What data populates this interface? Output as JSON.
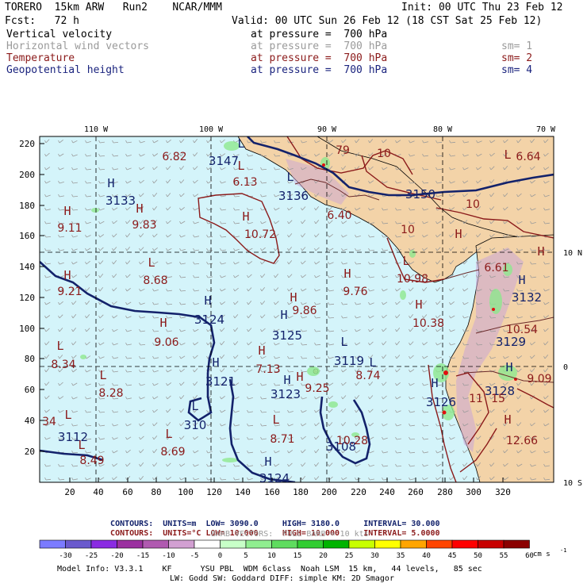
{
  "header": {
    "line1_left": "TORERO  15km ARW   Run2    NCAR/MMM",
    "line1_right": "Init: 00 UTC Thu 23 Feb 12",
    "line2_left": "Fcst:   72 h",
    "line2_right": "Valid: 00 UTC Sun 26 Feb 12 (18 CST Sat 25 Feb 12)"
  },
  "fields": [
    {
      "name": "Vertical velocity",
      "level": "at pressure =  700 hPa",
      "sm": "",
      "color": "#000000"
    },
    {
      "name": "Horizontal wind vectors",
      "level": "at pressure =  700 hPa",
      "sm": "sm= 1",
      "color": "#9a9a9a"
    },
    {
      "name": "Temperature",
      "level": "at pressure =  700 hPa",
      "sm": "sm= 2",
      "color": "#8b1a1a"
    },
    {
      "name": "Geopotential height",
      "level": "at pressure =  700 hPa",
      "sm": "sm= 4",
      "color": "#1a237e"
    }
  ],
  "map": {
    "lon_labels": [
      "110 W",
      "100 W",
      "90 W",
      "80 W",
      "70 W"
    ],
    "lat_labels": [
      "10 N",
      "0",
      "10 S"
    ],
    "y_ticks": [
      "220",
      "200",
      "180",
      "160",
      "140",
      "120",
      "100",
      "80",
      "60",
      "40",
      "20"
    ],
    "x_ticks": [
      "20",
      "40",
      "60",
      "80",
      "100",
      "120",
      "140",
      "160",
      "180",
      "200",
      "220",
      "240",
      "260",
      "280",
      "300",
      "320"
    ],
    "height_labels": [
      {
        "t": "3147"
      },
      {
        "t": "3133"
      },
      {
        "t": "3136"
      },
      {
        "t": "3150"
      },
      {
        "t": "3132"
      },
      {
        "t": "3124"
      },
      {
        "t": "3125"
      },
      {
        "t": "3129"
      },
      {
        "t": "3119"
      },
      {
        "t": "3121"
      },
      {
        "t": "3123"
      },
      {
        "t": "3126"
      },
      {
        "t": "3128"
      },
      {
        "t": "310"
      },
      {
        "t": "3112"
      },
      {
        "t": "3108"
      },
      {
        "t": "3124"
      }
    ],
    "temp_labels": [
      {
        "t": "6.82"
      },
      {
        "t": "6.13"
      },
      {
        "t": "10"
      },
      {
        "t": "6.64"
      },
      {
        "t": "9.11"
      },
      {
        "t": "9.83"
      },
      {
        "t": "6.40"
      },
      {
        "t": "10"
      },
      {
        "t": "10.72"
      },
      {
        "t": "10"
      },
      {
        "t": "8.68"
      },
      {
        "t": "9.76"
      },
      {
        "t": "10.98"
      },
      {
        "t": "6.61"
      },
      {
        "t": "9.21"
      },
      {
        "t": "9.86"
      },
      {
        "t": "10.38"
      },
      {
        "t": "10.54"
      },
      {
        "t": "9.06"
      },
      {
        "t": "8.34"
      },
      {
        "t": "7.13"
      },
      {
        "t": "8.74"
      },
      {
        "t": "9.09"
      },
      {
        "t": "8.28"
      },
      {
        "t": "9.25"
      },
      {
        "t": "11"
      },
      {
        "t": "15"
      },
      {
        "t": "34"
      },
      {
        "t": "8.71"
      },
      {
        "t": "10.28"
      },
      {
        "t": "12.66"
      },
      {
        "t": "8.69"
      },
      {
        "t": "8.49"
      },
      {
        "t": "79"
      }
    ]
  },
  "summary": {
    "line1": {
      "label": "CONTOURS:  UNITS=m  LOW=",
      "low": "3090.0",
      "high_label": "HIGH=",
      "high": "3180.0",
      "int_label": "INTERVAL=",
      "interval": "30.000"
    },
    "line2": {
      "label": "CONTOURS:  UNITS=°C LOW=",
      "low": "10.000",
      "high_label": "HIGH=",
      "high": "10.000",
      "int_label": "INTERVAL=",
      "interval": "5.0000"
    },
    "barbs": "BARB VECTORS:  FULL BARB = 10 kts"
  },
  "colorbar": {
    "labels": [
      "-30",
      "-25",
      "-20",
      "-15",
      "-10",
      "-5",
      "0",
      "5",
      "10",
      "15",
      "20",
      "25",
      "30",
      "35",
      "40",
      "45",
      "50",
      "55",
      "60"
    ],
    "colors": [
      "#7b7bff",
      "#6a5acd",
      "#8a2be2",
      "#9b30a0",
      "#b05ab0",
      "#d2a0d2",
      "#ffffff",
      "#c8ffc8",
      "#90ee90",
      "#5fdc5f",
      "#32cd32",
      "#00b400",
      "#c8ff00",
      "#ffff00",
      "#ffa500",
      "#ff4500",
      "#ff0000",
      "#c80000",
      "#8b0000"
    ],
    "units": "cm s",
    "units_exp": "-1"
  },
  "footer": {
    "line1": "Model Info: V3.3.1    KF      YSU PBL  WDM 6class  Noah LSM  15 km,   44 levels,   85 sec",
    "line2": "LW: Godd SW: Goddard DIFF: simple KM: 2D Smagor"
  }
}
